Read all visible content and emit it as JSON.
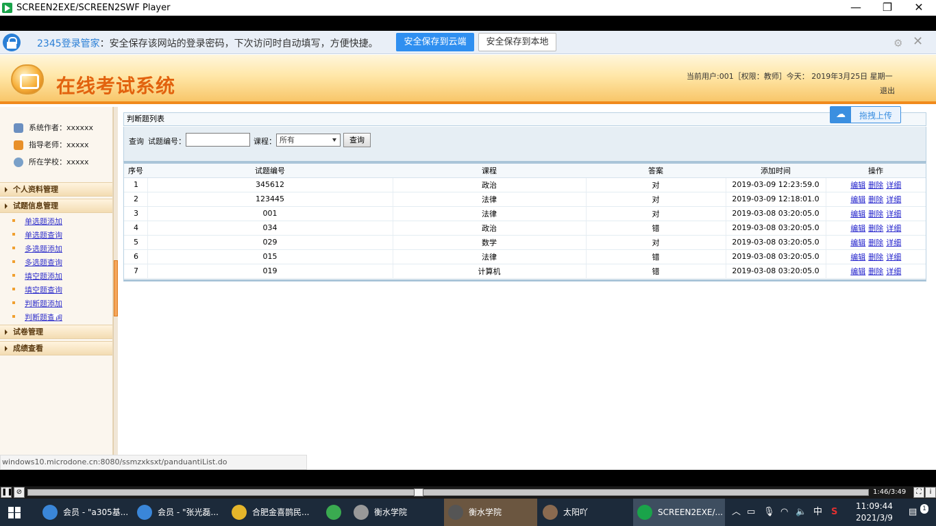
{
  "window": {
    "title": "SCREEN2EXE/SCREEN2SWF Player",
    "minimize": "—",
    "restore": "❐",
    "close": "✕"
  },
  "pwd_bar": {
    "brand": "2345登录管家",
    "message": "：安全保存该网站的登录密码，下次访问时自动填写，方便快捷。",
    "btn_cloud": "安全保存到云端",
    "btn_local": "安全保存到本地",
    "close": "✕",
    "gear": "⚙"
  },
  "header": {
    "title": "在线考试系统",
    "user_info": "当前用户:001［权限：教师］今天： 2019年3月25日   星期一",
    "logout": "退出"
  },
  "sidebar": {
    "info": [
      {
        "label": "系统作者：xxxxxx",
        "icon": "user-icon",
        "color": "#6b8fc0"
      },
      {
        "label": "指导老师：xxxxx",
        "icon": "teacher-icon",
        "color": "#e8902a"
      },
      {
        "label": "所在学校：xxxxx",
        "icon": "school-icon",
        "color": "#7aa0c8"
      }
    ],
    "sections": [
      "个人资料管理",
      "试题信息管理",
      "试卷管理",
      "成绩查看"
    ],
    "subitems": [
      "单选题添加",
      "单选题查询",
      "多选题添加",
      "多选题查询",
      "填空题添加",
      "填空题查询",
      "判断题添加",
      "判断题查询"
    ]
  },
  "main": {
    "list_title": "判断题列表",
    "upload_label": "拖拽上传",
    "query": {
      "label_query": "查询",
      "label_code": "试题编号：",
      "code_value": "",
      "label_course": "课程：",
      "course_selected": "所有",
      "btn_query": "查询"
    },
    "table": {
      "columns": [
        "序号",
        "试题编号",
        "课程",
        "答案",
        "添加时间",
        "操作"
      ],
      "actions": [
        "编辑",
        "删除",
        "详细"
      ],
      "rows": [
        [
          "1",
          "345612",
          "政治",
          "对",
          "2019-03-09 12:23:59.0"
        ],
        [
          "2",
          "123445",
          "法律",
          "对",
          "2019-03-09 12:18:01.0"
        ],
        [
          "3",
          "001",
          "法律",
          "对",
          "2019-03-08 03:20:05.0"
        ],
        [
          "4",
          "034",
          "政治",
          "错",
          "2019-03-08 03:20:05.0"
        ],
        [
          "5",
          "029",
          "数学",
          "对",
          "2019-03-08 03:20:05.0"
        ],
        [
          "6",
          "015",
          "法律",
          "错",
          "2019-03-08 03:20:05.0"
        ],
        [
          "7",
          "019",
          "计算机",
          "错",
          "2019-03-08 03:20:05.0"
        ]
      ]
    }
  },
  "status_url": "windows10.microdone.cn:8080/ssmzxksxt/panduantiList.do",
  "player": {
    "time": "1:46/3:49",
    "progress": 0.46
  },
  "taskbar": {
    "items": [
      {
        "label": "会员 - \"a305基...",
        "color": "#3a86d8"
      },
      {
        "label": "会员 - \"张光磊...",
        "color": "#3a86d8"
      },
      {
        "label": "合肥金喜鹊民...",
        "color": "#e5b52a"
      },
      {
        "label": "",
        "color": "#3aaa50"
      },
      {
        "label": "衡水学院",
        "color": "#999999"
      },
      {
        "label": "衡水学院",
        "color": "#555555"
      },
      {
        "label": "太阳吖",
        "color": "#8a6a50"
      },
      {
        "label": "SCREEN2EXE/...",
        "color": "#1aa34a"
      }
    ],
    "tray_ime": "中",
    "time": "11:09:44",
    "date": "2021/3/9",
    "notify_count": "1"
  }
}
